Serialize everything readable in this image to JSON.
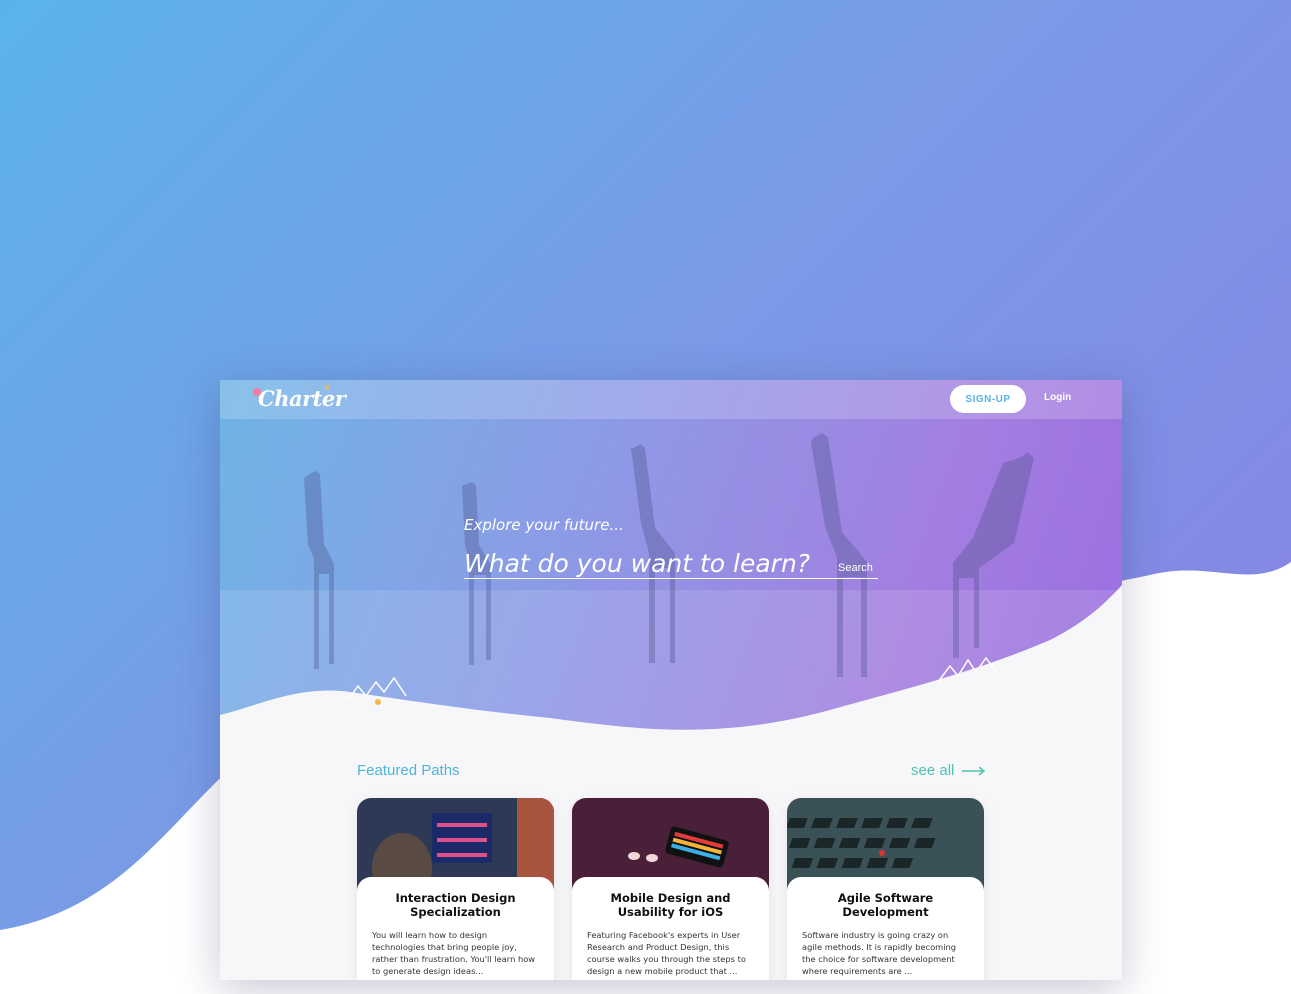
{
  "header": {
    "logo_text": "Charter",
    "signup_label": "SIGN-UP",
    "login_label": "Login"
  },
  "hero": {
    "tagline": "Explore your future...",
    "search_placeholder": "What do you want to learn?",
    "search_label": "Search"
  },
  "featured": {
    "title": "Featured Paths",
    "see_all_label": "see all",
    "cards": [
      {
        "title": "Interaction Design Specialization",
        "description": "You will learn how to design technologies that bring people joy, rather than frustration. You'll learn how to generate design ideas..."
      },
      {
        "title": "Mobile Design and Usability for iOS",
        "description": "Featuring Facebook's experts in User Research and Product Design, this course walks you through the steps to design a new mobile product that ..."
      },
      {
        "title": "Agile Software Development",
        "description": "Software industry is going crazy on agile methods.  It is rapidly becoming the choice for software development where requirements are ..."
      }
    ]
  },
  "colors": {
    "accent_blue": "#4fb6d9",
    "accent_teal": "#4fc3b0",
    "hero_gradient_start": "#6fb4e6",
    "hero_gradient_end": "#9a6de0"
  }
}
